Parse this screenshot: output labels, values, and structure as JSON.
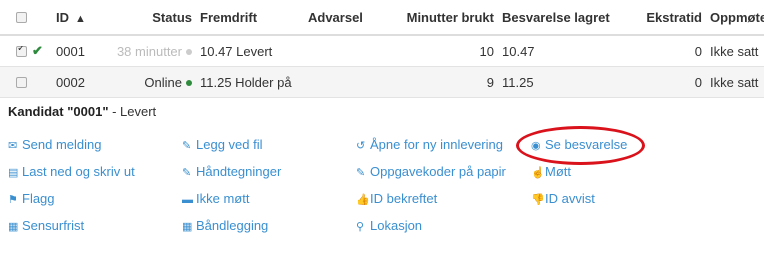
{
  "table": {
    "headers": [
      "",
      "",
      "ID",
      "Status",
      "Fremdrift",
      "Advarsel",
      "Minutter brukt",
      "Besvarelse lagret",
      "Ekstratid",
      "Oppmøte"
    ],
    "sort_indicator": "▲",
    "rows": [
      {
        "checked": true,
        "check_mark": "✔",
        "id": "0001",
        "status": "38 minutter",
        "status_dot_color": "#cccccc",
        "fremdrift": "10.47 Levert",
        "advarsel": "",
        "minutter": "10",
        "lagret": "10.47",
        "ekstratid": "0",
        "oppmote": "Ikke satt"
      },
      {
        "checked": false,
        "check_mark": "",
        "id": "0002",
        "status": "Online",
        "status_dot_color": "#2e8b3e",
        "fremdrift": "11.25 Holder på",
        "advarsel": "",
        "minutter": "9",
        "lagret": "11.25",
        "ekstratid": "0",
        "oppmote": "Ikke satt"
      }
    ]
  },
  "candidate": {
    "prefix": "Kandidat ",
    "name": "\"0001\"",
    "suffix": " - Levert"
  },
  "actions": [
    {
      "label": "Send melding",
      "icon": "envelope-icon",
      "glyph": "✉"
    },
    {
      "label": "Legg ved fil",
      "icon": "paperclip-icon",
      "glyph": "✎"
    },
    {
      "label": "Åpne for ny innlevering",
      "icon": "undo-icon",
      "glyph": "↺"
    },
    {
      "label": "Se besvarelse",
      "icon": "eye-icon",
      "glyph": "◉"
    },
    {
      "label": "Last ned og skriv ut",
      "icon": "file-icon",
      "glyph": "▤"
    },
    {
      "label": "Håndtegninger",
      "icon": "edit-icon",
      "glyph": "✎"
    },
    {
      "label": "Oppgavekoder på papir",
      "icon": "edit-icon",
      "glyph": "✎"
    },
    {
      "label": "Møtt",
      "icon": "hand-icon",
      "glyph": "☝"
    },
    {
      "label": "Flagg",
      "icon": "flag-icon",
      "glyph": "⚑"
    },
    {
      "label": "Ikke møtt",
      "icon": "bed-icon",
      "glyph": "▬"
    },
    {
      "label": "ID bekreftet",
      "icon": "thumbs-up-icon",
      "glyph": "👍"
    },
    {
      "label": "ID avvist",
      "icon": "thumbs-down-icon",
      "glyph": "👎"
    },
    {
      "label": "Sensurfrist",
      "icon": "calendar-icon",
      "glyph": "▦"
    },
    {
      "label": "Båndlegging",
      "icon": "calendar-icon",
      "glyph": "▦"
    },
    {
      "label": "Lokasjon",
      "icon": "map-marker-icon",
      "glyph": "⚲"
    }
  ],
  "colors": {
    "link": "#3a8fd0",
    "highlight_circle": "#d9121b",
    "online": "#2e8b3e"
  }
}
